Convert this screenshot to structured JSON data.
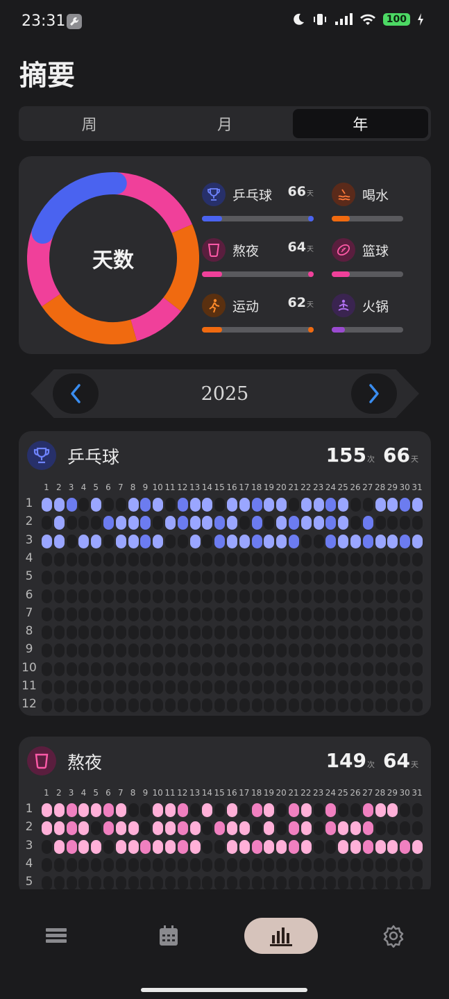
{
  "status": {
    "time": "23:31",
    "battery": "100"
  },
  "page_title": "摘要",
  "tabs": [
    {
      "label": "周",
      "active": false
    },
    {
      "label": "月",
      "active": false
    },
    {
      "label": "年",
      "active": true
    }
  ],
  "summary": {
    "center_label": "天数",
    "donut_segments": [
      {
        "name": "乒乓球",
        "color": "#4a63f0",
        "fraction": 0.2
      },
      {
        "name": "熬夜",
        "color": "#f0409a",
        "fraction": 0.18
      },
      {
        "name": "运动",
        "color": "#f06a10",
        "fraction": 0.17
      },
      {
        "name": "熬夜",
        "color": "#f0409a",
        "fraction": 0.1
      },
      {
        "name": "运动",
        "color": "#f06a10",
        "fraction": 0.2
      },
      {
        "name": "熬夜",
        "color": "#f0409a",
        "fraction": 0.15
      }
    ],
    "legend": [
      {
        "name": "乒乓球",
        "value": "66",
        "unit": "天",
        "color": "#4a63f0",
        "icon_bg": "#27306a",
        "icon": "trophy-icon",
        "fill_fraction": 0.18
      },
      {
        "name": "喝水",
        "value": "",
        "unit": "",
        "color": "#f06a10",
        "icon_bg": "#5a2a1a",
        "icon": "water-icon",
        "fill_fraction": 0.25
      },
      {
        "name": "熬夜",
        "value": "64",
        "unit": "天",
        "color": "#f0409a",
        "icon_bg": "#5a1e3e",
        "icon": "cup-icon",
        "fill_fraction": 0.18
      },
      {
        "name": "篮球",
        "value": "",
        "unit": "",
        "color": "#f0409a",
        "icon_bg": "#5a1e3e",
        "icon": "football-icon",
        "fill_fraction": 0.25
      },
      {
        "name": "运动",
        "value": "62",
        "unit": "天",
        "color": "#f06a10",
        "icon_bg": "#5a3010",
        "icon": "runner-icon",
        "fill_fraction": 0.17
      },
      {
        "name": "火锅",
        "value": "",
        "unit": "",
        "color": "#9a4ad0",
        "icon_bg": "#3a2450",
        "icon": "meditation-icon",
        "fill_fraction": 0.0
      }
    ]
  },
  "year_nav": {
    "year": "2025"
  },
  "activities": [
    {
      "id": "pingpong",
      "name": "乒乓球",
      "count": "155",
      "count_unit": "次",
      "days": "66",
      "days_unit": "天",
      "color_light": "#9aa6ff",
      "color_dark": "#6c7cf0",
      "months_shown": 12,
      "rows": {
        "1": "1,2,3,5,8,9,10,12,13,14,16,17,18,19,20,22,23,24,25,28,29,30,31",
        "2": "2,6,7,8,9,11,12,13,14,15,16,18,20,21,22,23,24,25,27",
        "3": "1,2,4,5,7,8,9,10,13,15,16,17,18,19,20,21,24,25,26,27,28,29,30,31"
      }
    },
    {
      "id": "nightowl",
      "name": "熬夜",
      "count": "149",
      "count_unit": "次",
      "days": "64",
      "days_unit": "天",
      "color_light": "#ffb0d8",
      "color_dark": "#f080c0",
      "months_shown": 5,
      "rows": {
        "1": "1,2,3,4,5,6,7,10,11,12,14,16,18,19,21,22,24,27,28,29",
        "2": "1,2,3,4,6,7,8,10,11,12,13,15,16,17,19,21,22,24,25,26,27",
        "3": "2,3,4,5,7,8,9,10,11,12,13,16,17,18,19,20,21,22,25,26,27,28,29,30,31"
      }
    }
  ],
  "day_headers": [
    "1",
    "2",
    "3",
    "4",
    "5",
    "6",
    "7",
    "8",
    "9",
    "10",
    "11",
    "12",
    "13",
    "14",
    "15",
    "16",
    "17",
    "18",
    "19",
    "20",
    "21",
    "22",
    "23",
    "24",
    "25",
    "26",
    "27",
    "28",
    "29",
    "30",
    "31"
  ],
  "month_labels": [
    "1",
    "2",
    "3",
    "4",
    "5",
    "6",
    "7",
    "8",
    "9",
    "10",
    "11",
    "12"
  ],
  "bottom_nav": [
    {
      "name": "list",
      "icon": "list-icon",
      "active": false
    },
    {
      "name": "calendar",
      "icon": "calendar-icon",
      "active": false
    },
    {
      "name": "stats",
      "icon": "bar-chart-icon",
      "active": true
    },
    {
      "name": "settings",
      "icon": "gear-icon",
      "active": false
    }
  ]
}
